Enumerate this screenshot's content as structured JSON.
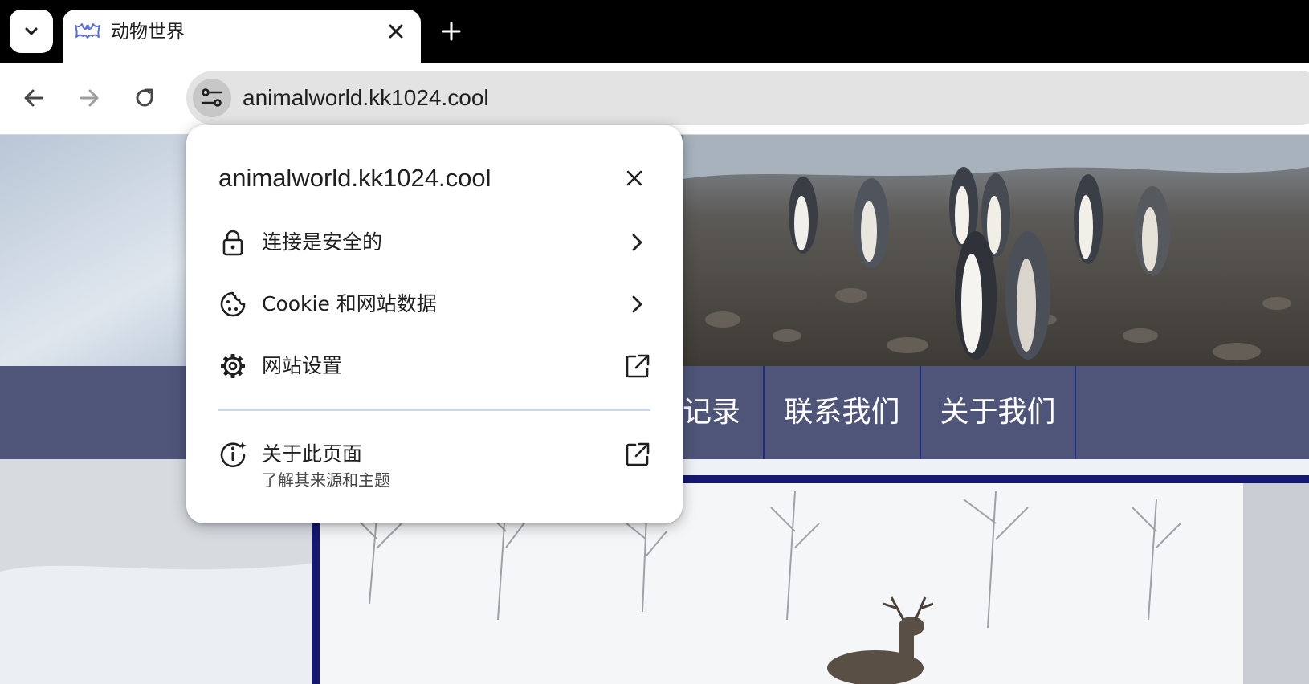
{
  "tab": {
    "title": "动物世界"
  },
  "omnibox": {
    "url": "animalworld.kk1024.cool"
  },
  "page": {
    "nav_items": [
      "记录",
      "联系我们",
      "关于我们"
    ]
  },
  "site_info_popup": {
    "host": "animalworld.kk1024.cool",
    "items": [
      {
        "label": "连接是安全的",
        "icon": "lock-icon",
        "trail": "chevron-right-icon"
      },
      {
        "label": "Cookie 和网站数据",
        "icon": "cookie-icon",
        "trail": "chevron-right-icon"
      },
      {
        "label": "网站设置",
        "icon": "gear-icon",
        "trail": "open-external-icon"
      }
    ],
    "about": {
      "label": "关于此页面",
      "sublabel": "了解其来源和主题",
      "icon": "about-page-icon",
      "trail": "open-external-icon"
    }
  },
  "colors": {
    "navbar": "#4f5578",
    "nav_border": "#1f2a80",
    "photo_frame": "#15186e"
  }
}
